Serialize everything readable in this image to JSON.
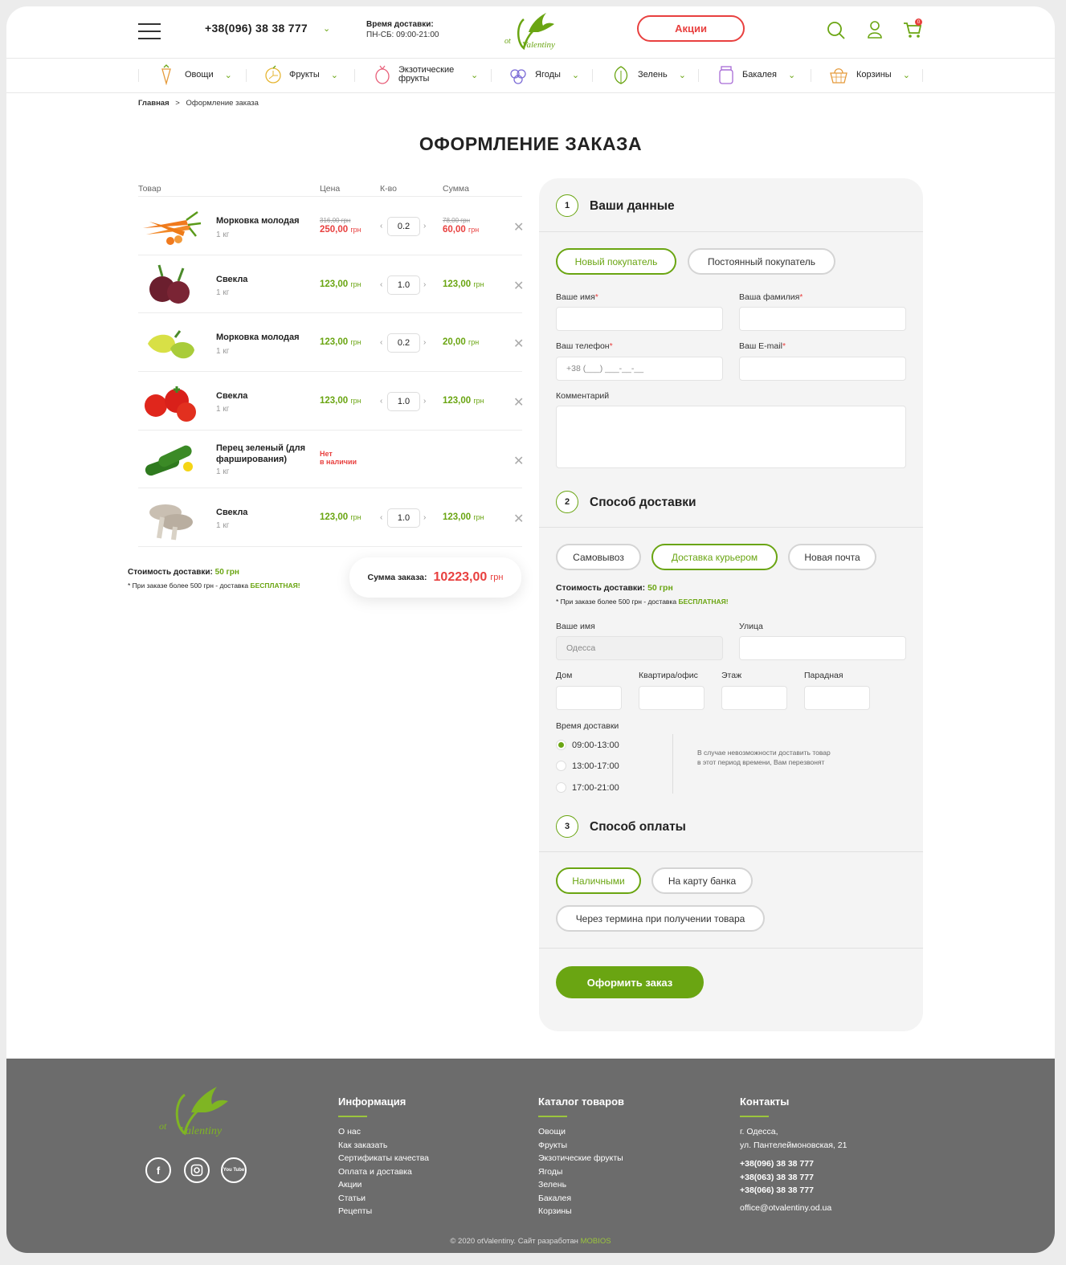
{
  "header": {
    "phone": "+38(096) 38 38 777",
    "delivery_label": "Время доставки:",
    "delivery_hours": "ПН-СБ: 09:00-21:00",
    "logo_small": "ot",
    "logo_big": "Valentiny",
    "promo_label": "Акции",
    "cart_count": "0"
  },
  "nav": [
    {
      "label": "Овощи",
      "icon": "carrot-icon"
    },
    {
      "label": "Фрукты",
      "icon": "orange-icon"
    },
    {
      "label": "Экзотические фрукты",
      "icon": "pitaya-icon"
    },
    {
      "label": "Ягоды",
      "icon": "berries-icon"
    },
    {
      "label": "Зелень",
      "icon": "lettuce-icon"
    },
    {
      "label": "Бакалея",
      "icon": "jar-icon"
    },
    {
      "label": "Корзины",
      "icon": "basket-icon"
    }
  ],
  "breadcrumb": {
    "home": "Главная",
    "sep": ">",
    "current": "Оформление заказа"
  },
  "page_title": "ОФОРМЛЕНИЕ ЗАКАЗА",
  "cart": {
    "headers": {
      "product": "Товар",
      "price": "Цена",
      "qty": "К-во",
      "sum": "Сумма"
    },
    "currency": "грн",
    "items": [
      {
        "name": "Морковка молодая",
        "unit": "1 кг",
        "old_price": "316,00 грн",
        "price": "250,00",
        "qty": "0.2",
        "old_sum": "78,00 грн",
        "sum": "60,00",
        "sale": true
      },
      {
        "name": "Свекла",
        "unit": "1 кг",
        "price": "123,00",
        "qty": "1.0",
        "sum": "123,00"
      },
      {
        "name": "Морковка молодая",
        "unit": "1 кг",
        "price": "123,00",
        "qty": "0.2",
        "sum": "20,00"
      },
      {
        "name": "Свекла",
        "unit": "1 кг",
        "price": "123,00",
        "qty": "1.0",
        "sum": "123,00"
      },
      {
        "name": "Перец зеленый (для фарширования)",
        "unit": "1 кг",
        "unavailable_1": "Нет",
        "unavailable_2": "в наличии"
      },
      {
        "name": "Свекла",
        "unit": "1 кг",
        "price": "123,00",
        "qty": "1.0",
        "sum": "123,00"
      }
    ],
    "shipping_label": "Стоимость доставки:",
    "shipping_value": "50 грн",
    "shipping_note": "* При заказе более 500 грн -  доставка",
    "shipping_free": "БЕСПЛАТНАЯ!",
    "total_label": "Сумма заказа:",
    "total_value": "10223,00",
    "total_cur": "грн"
  },
  "form": {
    "step1": {
      "num": "1",
      "title": "Ваши данные",
      "new_buyer": "Новый покупатель",
      "regular_buyer": "Постоянный покупатель",
      "first_name": "Ваше имя",
      "last_name": "Ваша фамилия",
      "phone": "Ваш телефон",
      "phone_placeholder": "+38 (___) ___-__-__",
      "email": "Ваш E-mail",
      "comment": "Комментарий"
    },
    "step2": {
      "num": "2",
      "title": "Способ доставки",
      "pickup": "Самовывоз",
      "courier": "Доставка курьером",
      "nova_poshta": "Новая почта",
      "cost_label": "Стоимость доставки:",
      "cost_value": "50 грн",
      "note": "* При заказе более 500 грн -  доставка",
      "free": "БЕСПЛАТНАЯ!",
      "city_label": "Ваше имя",
      "city_value": "Одесса",
      "street": "Улица",
      "house": "Дом",
      "apartment": "Квартира/офис",
      "floor": "Этаж",
      "entrance": "Парадная",
      "time_label": "Время доставки",
      "times": [
        "09:00-13:00",
        "13:00-17:00",
        "17:00-21:00"
      ],
      "time_note": "В случае невозможности доставить товар в этот период времени, Вам перезвонят"
    },
    "step3": {
      "num": "3",
      "title": "Способ оплаты",
      "cash": "Наличными",
      "card": "На карту банка",
      "terminal": "Через термина при получении товара"
    },
    "submit": "Оформить заказ"
  },
  "footer": {
    "info_title": "Информация",
    "info_links": [
      "О нас",
      "Как заказать",
      "Сертификаты качества",
      "Оплата и доставка",
      "Акции",
      "Статьи",
      "Рецепты"
    ],
    "catalog_title": "Каталог товаров",
    "catalog_links": [
      "Овощи",
      "Фрукты",
      "Экзотические фрукты",
      "Ягоды",
      "Зелень",
      "Бакалея",
      "Корзины"
    ],
    "contacts_title": "Контакты",
    "address_1": "г. Одесса,",
    "address_2": "ул. Пантелеймоновская, 21",
    "phones": [
      "+38(096) 38 38 777",
      "+38(063) 38 38 777",
      "+38(066) 38 38 777"
    ],
    "email": "office@otvalentiny.od.ua",
    "copyright": "© 2020 otValentiny. Сайт разработан",
    "dev": "MOBIOS",
    "social": [
      "f",
      "ig",
      "You Tube"
    ]
  },
  "colors": {
    "accent": "#6aa512",
    "sale": "#e8403f",
    "footer": "#6c6c6c"
  }
}
